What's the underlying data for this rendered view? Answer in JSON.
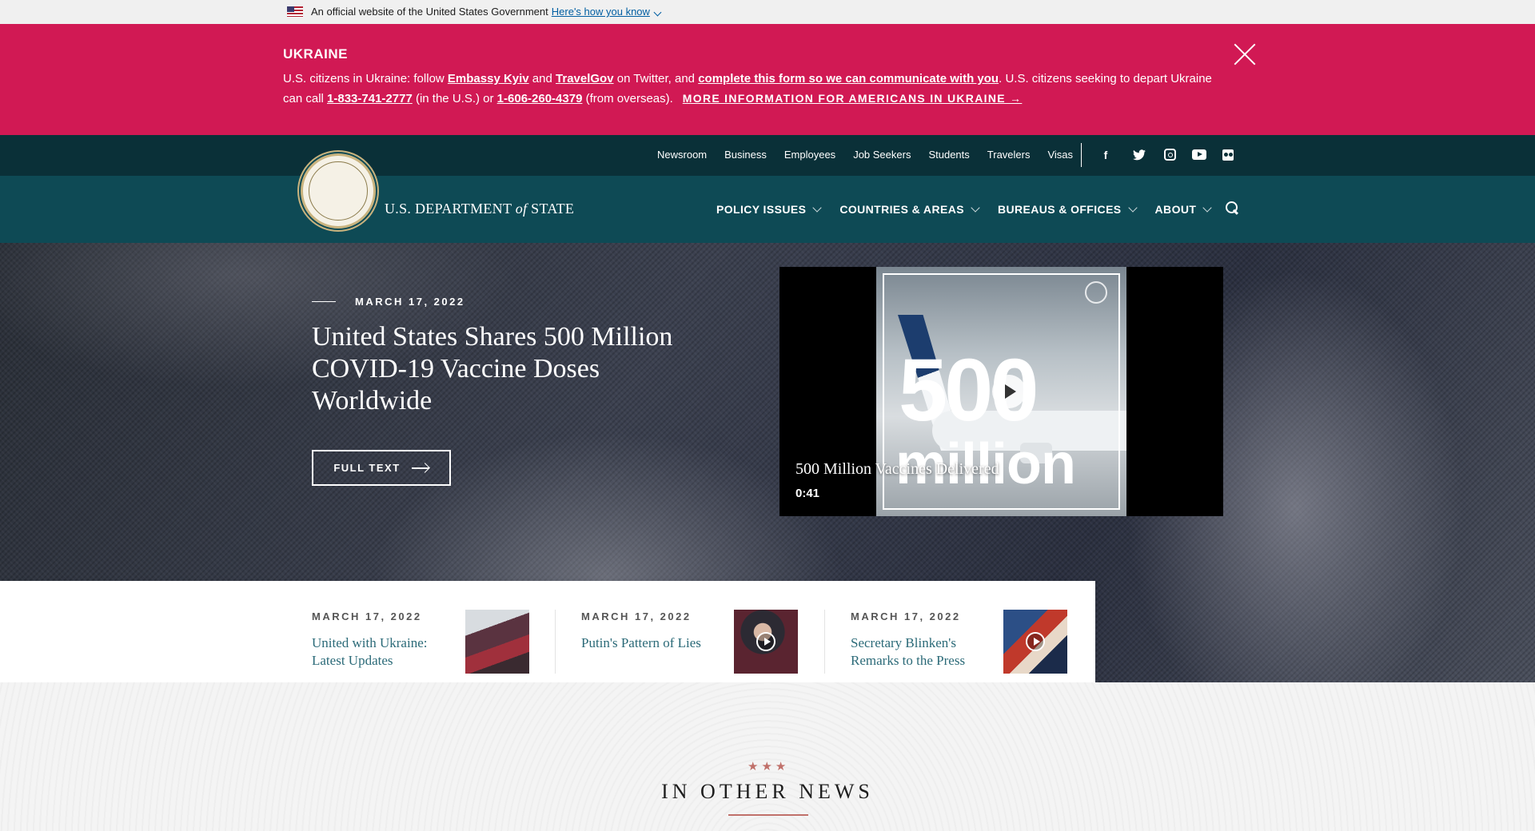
{
  "gov_banner": {
    "text": "An official website of the United States Government",
    "link": "Here's how you know"
  },
  "alert": {
    "title": "UKRAINE",
    "t1": "U.S. citizens in Ukraine: follow ",
    "link1": "Embassy Kyiv",
    "t2": " and ",
    "link2": "TravelGov",
    "t3": " on Twitter, and ",
    "link3": "complete this form so we can communicate with you",
    "t4": ". U.S. citizens seeking to depart Ukraine can call ",
    "phone1": "1-833-741-2777",
    "t5": " (in the U.S.) or ",
    "phone2": "1-606-260-4379",
    "t6": " (from overseas).",
    "more": "MORE INFORMATION FOR AMERICANS IN UKRAINE →",
    "accent": "#d11954"
  },
  "utility_nav": {
    "links": [
      "Newsroom",
      "Business",
      "Employees",
      "Job Seekers",
      "Students",
      "Travelers",
      "Visas"
    ],
    "social": [
      "facebook-icon",
      "twitter-icon",
      "instagram-icon",
      "youtube-icon",
      "flickr-icon"
    ]
  },
  "main_nav": {
    "dept_prefix": "U.S. DEPARTMENT ",
    "dept_of": "of",
    "dept_suffix": " STATE",
    "items": [
      "POLICY ISSUES",
      "COUNTRIES & AREAS",
      "BUREAUS & OFFICES",
      "ABOUT"
    ],
    "bg": "#0e4a55"
  },
  "hero": {
    "date": "MARCH 17, 2022",
    "title": "United States Shares 500 Million COVID-19 Vaccine Doses Worldwide",
    "button": "FULL TEXT",
    "video": {
      "thumb_big": "500",
      "thumb_small": "million",
      "caption": "500 Million Vaccines Delivered",
      "duration": "0:41"
    }
  },
  "featured": [
    {
      "date": "MARCH 17, 2022",
      "title": "United with Ukraine: Latest Updates"
    },
    {
      "date": "MARCH 17, 2022",
      "title": "Putin's Pattern of Lies"
    },
    {
      "date": "MARCH 17, 2022",
      "title": "Secretary Blinken's Remarks to the Press"
    }
  ],
  "other_news": {
    "stars": "★★★",
    "title": "IN OTHER NEWS"
  }
}
